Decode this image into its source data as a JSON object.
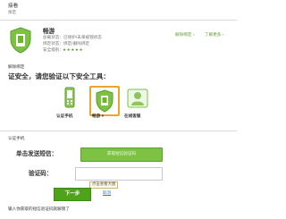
{
  "header": {
    "line1": "接看",
    "line2": "保定"
  },
  "device": {
    "name": "畅游",
    "lines": [
      "加载状态：已保护/未来被锁状态",
      "绑定状态：绑定/删除绑定",
      "安全级别："
    ],
    "stars": "★★★★★",
    "right_links": [
      "解除绑定 ›",
      "了解更多 ›"
    ]
  },
  "unbind": {
    "section_title": "解除绑定",
    "instruction": "证安全，请您验证以下安全工具：",
    "tools": [
      {
        "label": "认证手机",
        "icon": "phone-icon"
      },
      {
        "label": "畅游 ▾",
        "icon": "shield-icon"
      },
      {
        "label": "在线客服",
        "icon": "customer-service-icon"
      }
    ]
  },
  "verify_phone": {
    "section_title": "认证手机",
    "send_label": "单击发送短信：",
    "send_button": "获取短信验证码",
    "code_label": "验证码：",
    "code_value": "",
    "tooltip": "点击查看大图",
    "next_button": "下一步",
    "cancel_link": "取消",
    "footer_note": "输入你获取的短信验证码就解锁了"
  },
  "colors": {
    "accent_green": "#6cb52d",
    "button_green": "#4ea31b",
    "link_blue": "#2e7fc8"
  }
}
